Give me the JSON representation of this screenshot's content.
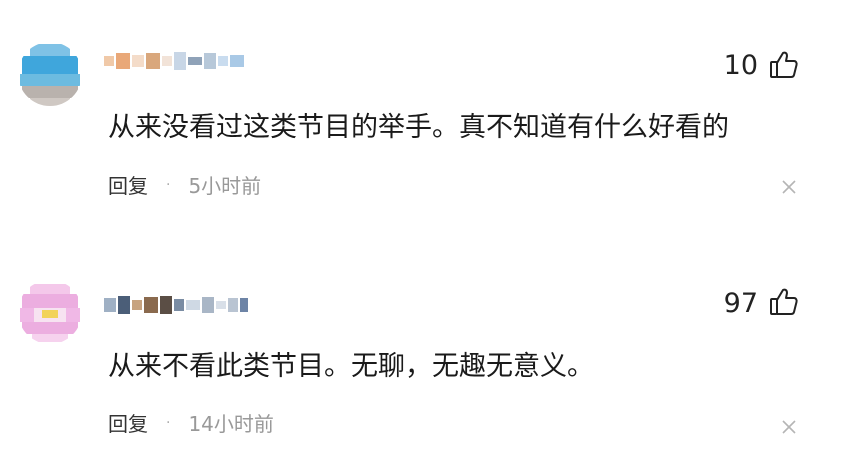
{
  "comments": [
    {
      "like_count": "10",
      "text": "从来没看过这类节目的举手。真不知道有什么好看的",
      "reply_label": "回复",
      "separator": "·",
      "time": "5小时前"
    },
    {
      "like_count": "97",
      "text": "从来不看此类节目。无聊，无趣无意义。",
      "reply_label": "回复",
      "separator": "·",
      "time": "14小时前"
    }
  ],
  "icons": {
    "like": "thumbs-up-icon",
    "close": "close-icon"
  },
  "colors": {
    "text": "#1a1a1a",
    "muted": "#999999",
    "icon": "#222222"
  }
}
